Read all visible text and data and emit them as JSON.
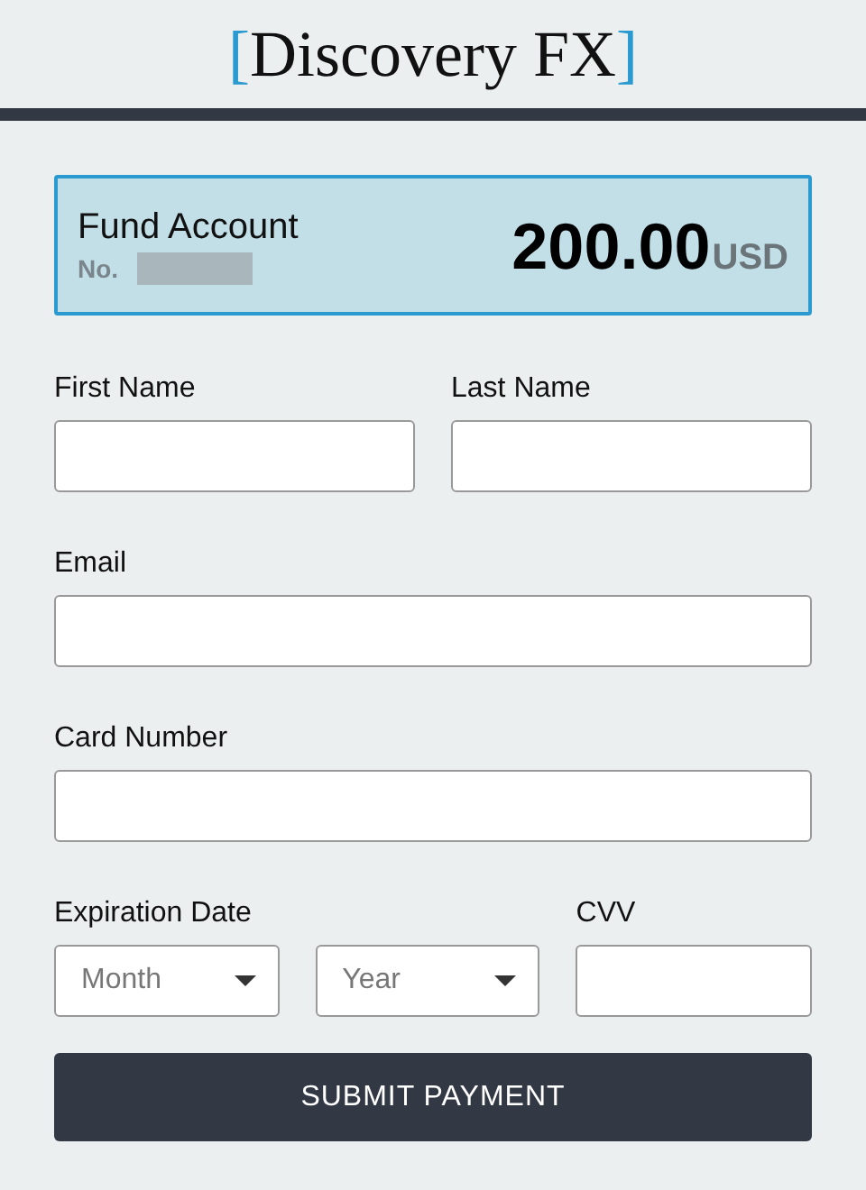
{
  "brand": {
    "open_bracket": "[",
    "name": "Discovery FX",
    "close_bracket": "]"
  },
  "account": {
    "title": "Fund Account",
    "number_label": "No.",
    "amount": "200.00",
    "currency": "USD"
  },
  "rows": [
    {
      "fields": [
        {
          "label": "First Name",
          "kind": "text"
        },
        {
          "label": "Last Name",
          "kind": "text"
        }
      ]
    },
    {
      "fields": [
        {
          "label": "Email",
          "kind": "text"
        }
      ]
    },
    {
      "fields": [
        {
          "label": "Card Number",
          "kind": "text"
        }
      ]
    },
    {
      "fields": [
        {
          "label": "Expiration Date",
          "kind": "selects",
          "options": [
            {
              "placeholder": "Month"
            },
            {
              "placeholder": "Year"
            }
          ]
        },
        {
          "label": "CVV",
          "kind": "text"
        }
      ]
    }
  ],
  "submit": {
    "label": "SUBMIT PAYMENT"
  }
}
